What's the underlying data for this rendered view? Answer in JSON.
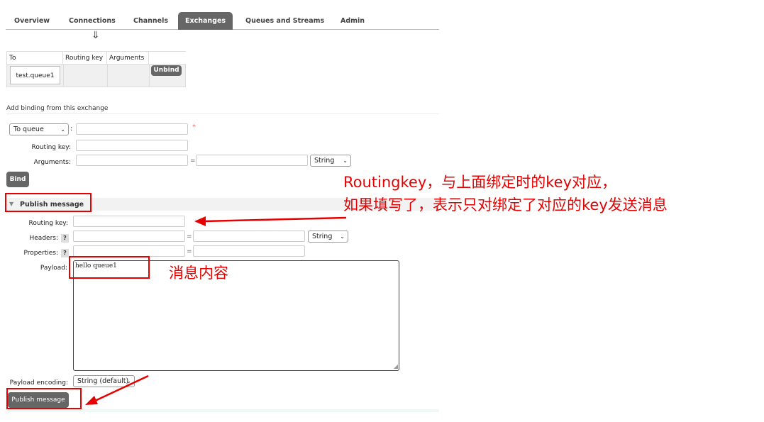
{
  "nav": {
    "tabs": [
      "Overview",
      "Connections",
      "Channels",
      "Exchanges",
      "Queues and Streams",
      "Admin"
    ],
    "active": "Exchanges"
  },
  "flow_arrow": "⇓",
  "bindings": {
    "headers": [
      "To",
      "Routing key",
      "Arguments"
    ],
    "rows": [
      {
        "to": "test.queue1",
        "routing_key": "",
        "arguments": "",
        "action": "Unbind"
      }
    ]
  },
  "add_binding": {
    "title": "Add binding from this exchange",
    "destination_type": "To queue",
    "colon": ":",
    "required_mark": "*",
    "routing_key_label": "Routing key:",
    "arguments_label": "Arguments:",
    "equals": "=",
    "arg_type": "String",
    "bind_button": "Bind"
  },
  "publish": {
    "title": "Publish message",
    "routing_key_label": "Routing key:",
    "headers_label": "Headers:",
    "properties_label": "Properties:",
    "help": "?",
    "equals": "=",
    "header_type": "String",
    "payload_label": "Payload:",
    "payload_value": "hello queue1",
    "encoding_label": "Payload encoding:",
    "encoding_value": "String (default)",
    "publish_button": "Publish message"
  },
  "annotations": {
    "routing_key_note_line1": "Routingkey，与上面绑定时的key对应，",
    "routing_key_note_line2": "如果填写了，表示只对绑定了对应的key发送消息",
    "payload_note": "消息内容"
  },
  "colors": {
    "annotation": "#e60000",
    "active_tab": "#666666",
    "button": "#666666"
  }
}
